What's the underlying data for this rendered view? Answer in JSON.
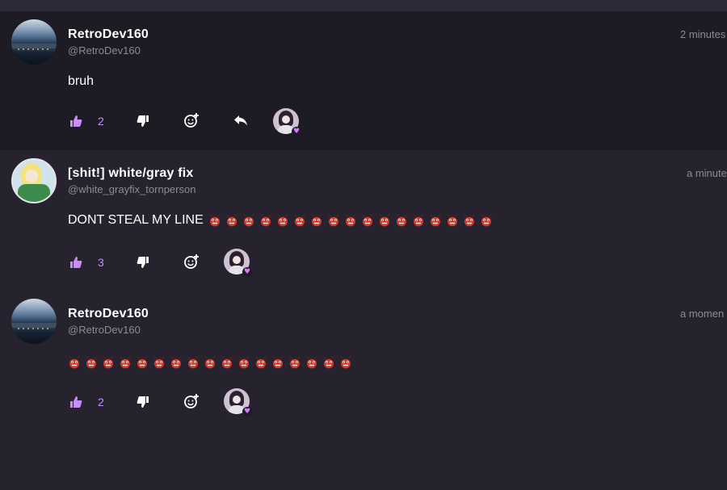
{
  "colors": {
    "accent": "#c98cff",
    "text_muted": "#8d8a96",
    "post_bg_highlight": "#1d1b24",
    "page_bg": "#26232f",
    "emoji_red": "#d23b2b"
  },
  "posts": [
    {
      "author": "RetroDev160",
      "handle": "@RetroDev160",
      "time": "2 minutes",
      "text": "bruh",
      "emoji_count": 0,
      "likes": "2",
      "avatar_icon": "landscape-avatar",
      "has_reply": true
    },
    {
      "author": "[shit!] white/gray fix",
      "handle": "@white_grayfix_tornperson",
      "time": "a minute",
      "text": "DONT STEAL MY LINE",
      "emoji_count": 17,
      "likes": "3",
      "avatar_icon": "anime-avatar",
      "has_reply": false
    },
    {
      "author": "RetroDev160",
      "handle": "@RetroDev160",
      "time": "a momen",
      "text": "",
      "emoji_count": 17,
      "likes": "2",
      "avatar_icon": "landscape-avatar",
      "has_reply": false
    }
  ],
  "icons": {
    "like": "thumbs-up-icon",
    "dislike": "thumbs-down-icon",
    "react": "add-reaction-icon",
    "reply": "reply-icon",
    "reaction_badge": "heart-icon",
    "emoji": "red-bug-emoji"
  }
}
